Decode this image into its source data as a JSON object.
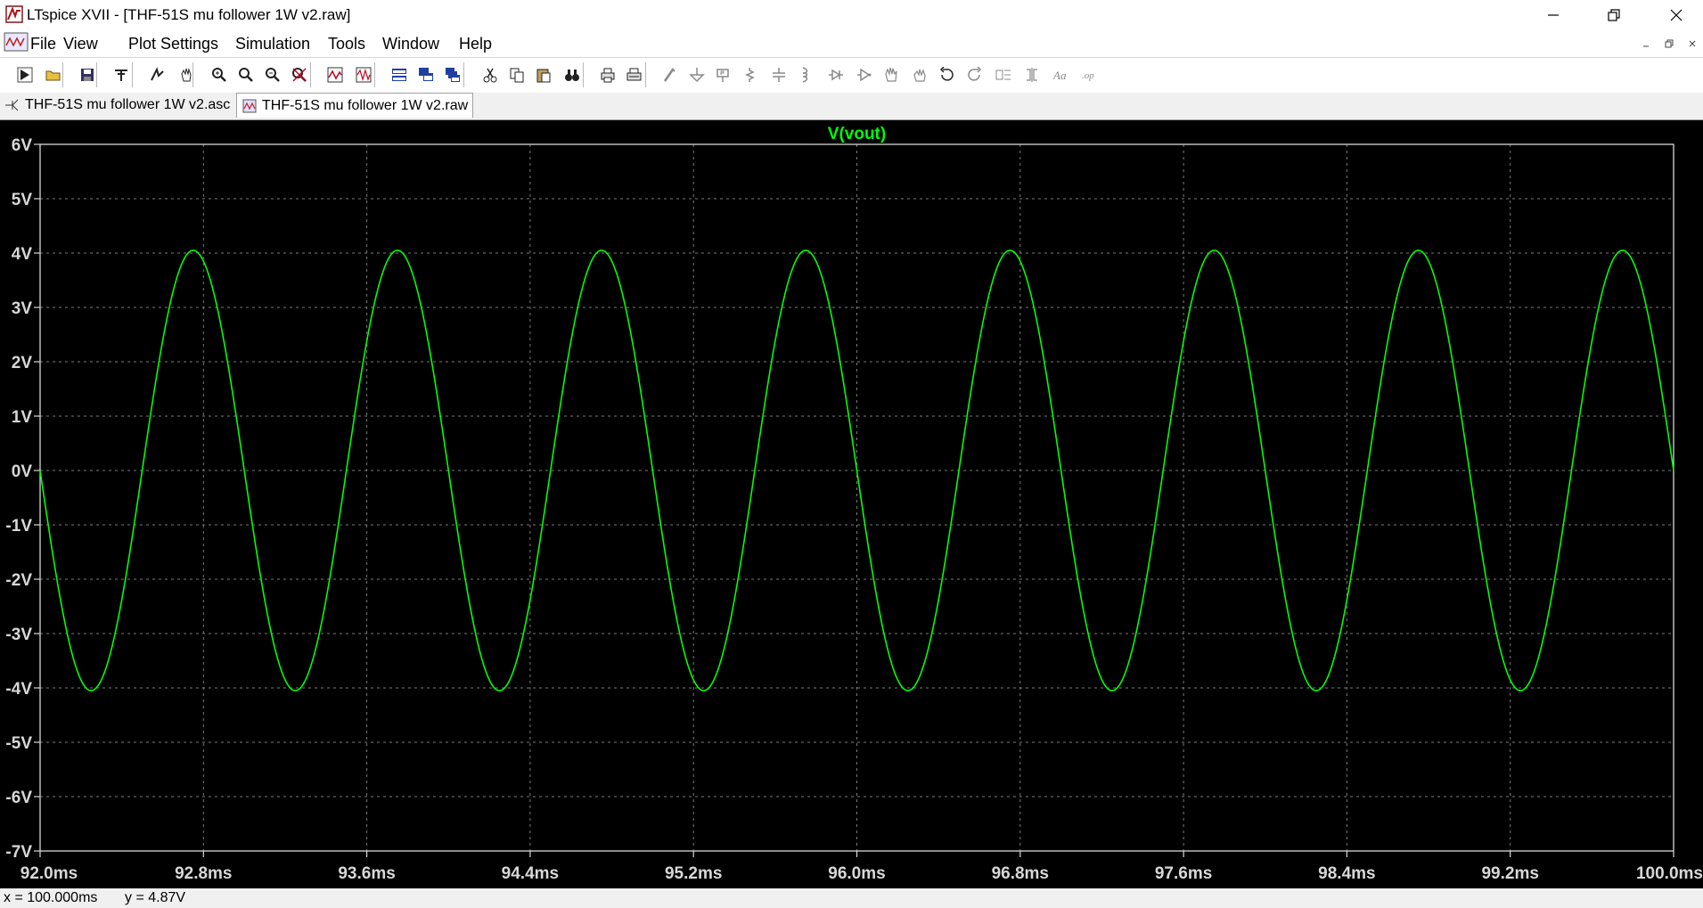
{
  "window": {
    "app_title": "LTspice XVII - [THF-51S mu follower 1W v2.raw]",
    "controls": [
      "minimize-icon",
      "restore-icon",
      "close-icon"
    ]
  },
  "menu": {
    "items": [
      "File",
      "View",
      "Plot Settings",
      "Simulation",
      "Tools",
      "Window",
      "Help"
    ]
  },
  "toolbar": {
    "buttons": [
      "run-icon",
      "open-icon",
      "save-icon",
      "control-panel-icon",
      "halt-icon",
      "pan-icon",
      "zoom-in-icon",
      "zoom-area-icon",
      "zoom-out-icon",
      "zoom-cancel-icon",
      "autorange-icon",
      "waveform-icon",
      "tile-horizontal-icon",
      "tile-vertical-icon",
      "cascade-icon",
      "cut-icon",
      "copy-icon",
      "paste-icon",
      "find-icon",
      "print-icon",
      "print-setup-icon",
      "wire-icon",
      "ground-icon",
      "label-net-icon",
      "resistor-icon",
      "capacitor-icon",
      "inductor-icon",
      "diode-icon",
      "component-icon",
      "move-icon",
      "drag-icon",
      "undo-icon",
      "redo-icon",
      "rotate-icon",
      "mirror-icon",
      "text-icon",
      "spice-directive-icon"
    ]
  },
  "tabs": [
    {
      "label": "THF-51S mu follower 1W v2.asc",
      "icon": "schematic-icon",
      "active": false
    },
    {
      "label": "THF-51S mu follower 1W v2.raw",
      "icon": "waveform-icon",
      "active": true
    }
  ],
  "status": {
    "x_readout": "x = 100.000ms",
    "y_readout": "y = 4.87V"
  },
  "colors": {
    "trace": "#00ff00",
    "plot_bg": "#000000",
    "axis_text": "#d8d8d8",
    "grid": "#7a7a7a"
  },
  "chart_data": {
    "type": "line",
    "title": "V(vout)",
    "series": [
      {
        "name": "V(vout)",
        "amplitude": 4.05,
        "frequency_hz": 1000,
        "phase_deg": 180
      }
    ],
    "xlim": [
      92.0,
      100.0
    ],
    "x_tick_values": [
      92.0,
      92.8,
      93.6,
      94.4,
      95.2,
      96.0,
      96.8,
      97.6,
      98.4,
      99.2,
      100.0
    ],
    "x_tick_labels": [
      "92.0ms",
      "92.8ms",
      "93.6ms",
      "94.4ms",
      "95.2ms",
      "96.0ms",
      "96.8ms",
      "97.6ms",
      "98.4ms",
      "99.2ms",
      "100.0ms"
    ],
    "ylim": [
      -7,
      6
    ],
    "y_tick_values": [
      6,
      5,
      4,
      3,
      2,
      1,
      0,
      -1,
      -2,
      -3,
      -4,
      -5,
      -6,
      -7
    ],
    "y_tick_labels": [
      "6V",
      "5V",
      "4V",
      "3V",
      "2V",
      "1V",
      "0V",
      "-1V",
      "-2V",
      "-3V",
      "-4V",
      "-5V",
      "-6V",
      "-7V"
    ],
    "grid": true
  }
}
